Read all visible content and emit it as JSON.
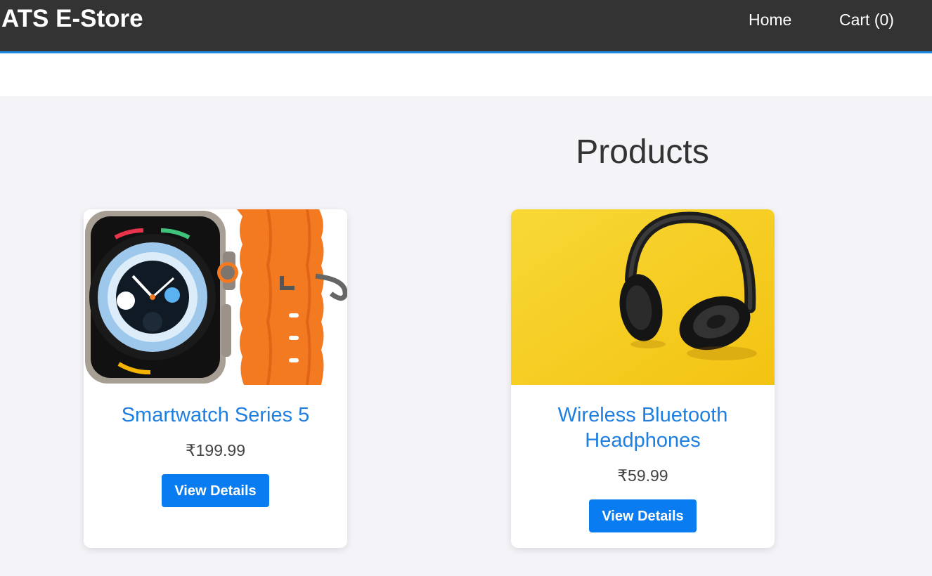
{
  "header": {
    "brand": "ATS E-Store",
    "nav": {
      "home": "Home",
      "cart": "Cart (0)"
    }
  },
  "main": {
    "title": "Products",
    "products": [
      {
        "name": "Smartwatch Series 5",
        "price": "₹199.99",
        "button": "View Details",
        "image": "smartwatch-image"
      },
      {
        "name": "Wireless Bluetooth Headphones",
        "price": "₹59.99",
        "button": "View Details",
        "image": "headphones-image"
      }
    ]
  },
  "colors": {
    "navbar_bg": "#333333",
    "navbar_border": "#1e88e5",
    "page_bg": "#f4f4f8",
    "link": "#1e7fe0",
    "button": "#0a7cf2"
  }
}
